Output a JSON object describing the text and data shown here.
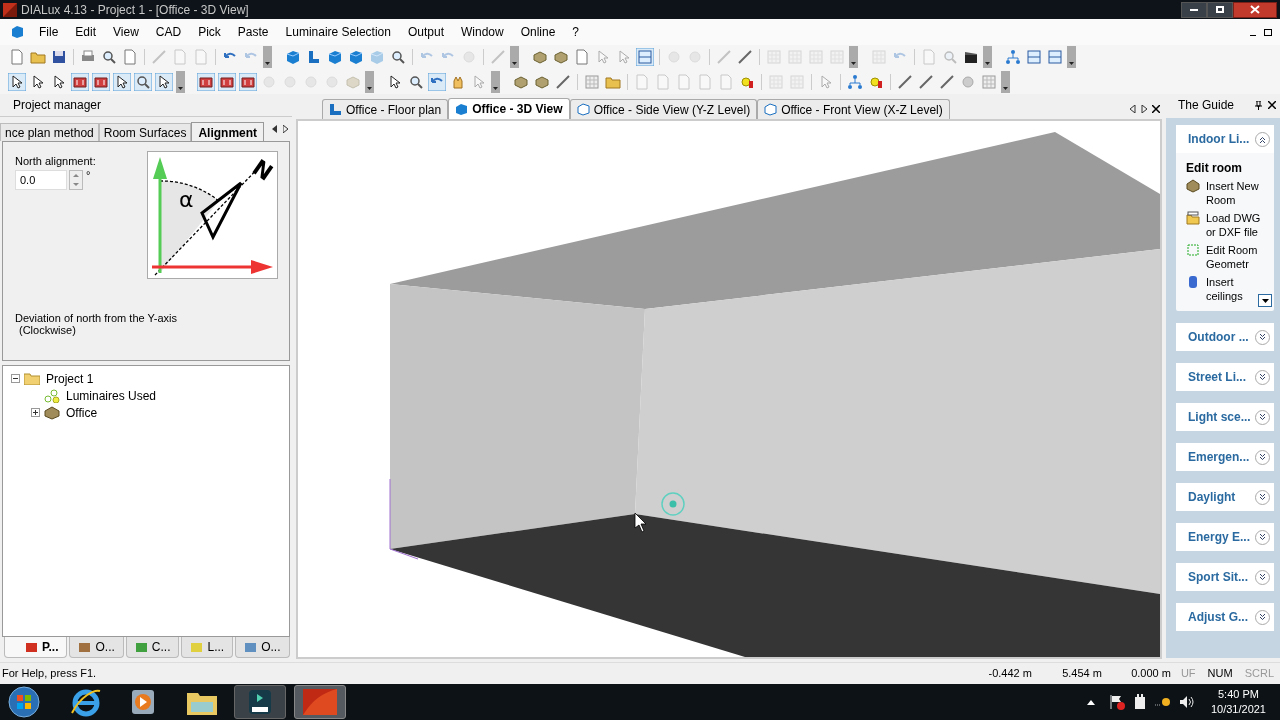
{
  "window": {
    "title": "DIALux 4.13 - Project 1 - [Office - 3D View]"
  },
  "menu": [
    "File",
    "Edit",
    "View",
    "CAD",
    "Pick",
    "Paste",
    "Luminaire Selection",
    "Output",
    "Window",
    "Online",
    "?"
  ],
  "project_manager": {
    "title": "Project manager",
    "tabs": [
      {
        "label": "nce plan method",
        "selected": false
      },
      {
        "label": "Room Surfaces",
        "selected": false
      },
      {
        "label": "Alignment",
        "selected": true
      }
    ],
    "north_alignment": {
      "label": "North alignment:",
      "value": "0.0",
      "unit": "°"
    },
    "diagram": {
      "angle": "α",
      "north": "N"
    },
    "description": "Deviation of north from the Y-axis",
    "description_note": "(Clockwise)",
    "tree": [
      {
        "label": "Project 1",
        "expanded": true,
        "children": [
          {
            "label": "Luminaires Used"
          },
          {
            "label": "Office",
            "expanded": false
          }
        ]
      }
    ],
    "bottom_tabs": [
      {
        "label": "P...",
        "selected": true
      },
      {
        "label": "O...",
        "selected": false
      },
      {
        "label": "C...",
        "selected": false
      },
      {
        "label": "L...",
        "selected": false
      },
      {
        "label": "O...",
        "selected": false
      }
    ]
  },
  "document_tabs": [
    {
      "label": "Office - Floor plan",
      "selected": false
    },
    {
      "label": "Office - 3D View",
      "selected": true
    },
    {
      "label": "Office - Side View (Y-Z Level)",
      "selected": false
    },
    {
      "label": "Office - Front View (X-Z Level)",
      "selected": false
    }
  ],
  "guide": {
    "title": "The Guide",
    "sections": [
      {
        "label": "Indoor Li...",
        "expanded": true,
        "group": "Edit room",
        "items": [
          "Insert New Room",
          "Load DWG or DXF file",
          "Edit Room Geometr",
          "Insert ceilings"
        ]
      },
      {
        "label": "Outdoor ...",
        "expanded": false
      },
      {
        "label": "Street Li...",
        "expanded": false
      },
      {
        "label": "Light sce...",
        "expanded": false
      },
      {
        "label": "Emergen...",
        "expanded": false
      },
      {
        "label": "Daylight",
        "expanded": false
      },
      {
        "label": "Energy E...",
        "expanded": false
      },
      {
        "label": "Sport Sit...",
        "expanded": false
      },
      {
        "label": "Adjust G...",
        "expanded": false
      }
    ]
  },
  "status_bar": {
    "help": "For Help, press F1.",
    "x": "-0.442 m",
    "y": "5.454 m",
    "z": "0.000 m",
    "indicators": [
      {
        "label": "UF",
        "on": false
      },
      {
        "label": "NUM",
        "on": true
      },
      {
        "label": "SCRL",
        "on": false
      }
    ]
  },
  "taskbar": {
    "time": "5:40 PM",
    "date": "10/31/2021"
  }
}
